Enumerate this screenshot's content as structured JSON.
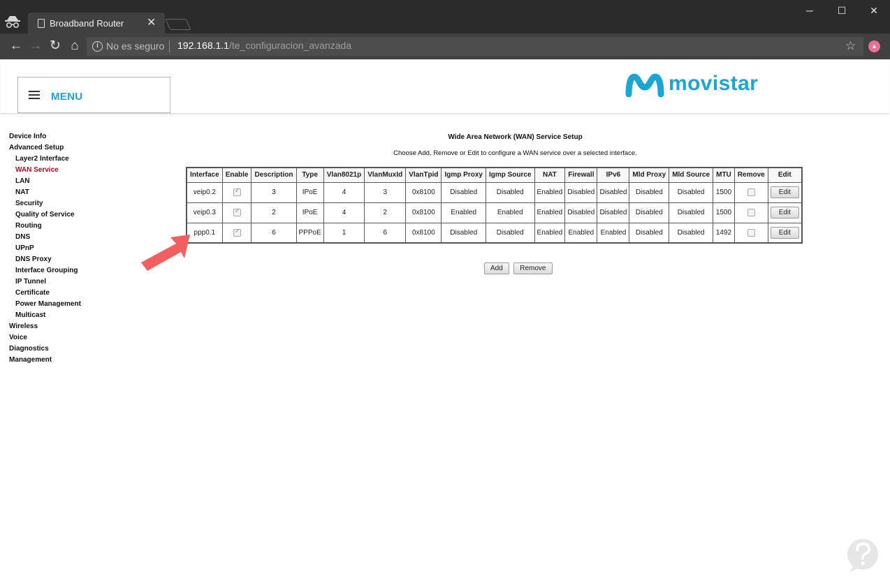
{
  "browser": {
    "tab_title": "Broadband Router",
    "security_text": "No es seguro",
    "url_host": "192.168.1.1",
    "url_path": "/te_configuracion_avanzada"
  },
  "header": {
    "menu_label": "MENU",
    "logo_text": "movistar",
    "brand_color": "#1aa6d2"
  },
  "left_nav": {
    "items": [
      {
        "label": "Device Info",
        "level": 0
      },
      {
        "label": "Advanced Setup",
        "level": 0
      },
      {
        "label": "Layer2 Interface",
        "level": 1
      },
      {
        "label": "WAN Service",
        "level": 1,
        "active": true
      },
      {
        "label": "LAN",
        "level": 1
      },
      {
        "label": "NAT",
        "level": 1
      },
      {
        "label": "Security",
        "level": 1
      },
      {
        "label": "Quality of Service",
        "level": 1
      },
      {
        "label": "Routing",
        "level": 1
      },
      {
        "label": "DNS",
        "level": 1
      },
      {
        "label": "UPnP",
        "level": 1
      },
      {
        "label": "DNS Proxy",
        "level": 1
      },
      {
        "label": "Interface Grouping",
        "level": 1
      },
      {
        "label": "IP Tunnel",
        "level": 1
      },
      {
        "label": "Certificate",
        "level": 1
      },
      {
        "label": "Power Management",
        "level": 1
      },
      {
        "label": "Multicast",
        "level": 1
      },
      {
        "label": "Wireless",
        "level": 0
      },
      {
        "label": "Voice",
        "level": 0
      },
      {
        "label": "Diagnostics",
        "level": 0
      },
      {
        "label": "Management",
        "level": 0
      }
    ],
    "active_color": "#c4051c"
  },
  "content": {
    "title": "Wide Area Network (WAN) Service Setup",
    "description": "Choose Add, Remove or Edit to configure a WAN service over a selected interface."
  },
  "wan_table": {
    "headers": [
      "Interface",
      "Enable",
      "Description",
      "Type",
      "Vlan8021p",
      "VlanMuxId",
      "VlanTpid",
      "Igmp Proxy",
      "Igmp Source",
      "NAT",
      "Firewall",
      "IPv6",
      "Mld Proxy",
      "Mld Source",
      "MTU",
      "Remove",
      "Edit"
    ],
    "rows": [
      {
        "interface": "veip0.2",
        "enable": true,
        "description": "3",
        "type": "IPoE",
        "vlan8021p": "4",
        "vlanmuxid": "3",
        "vlantpid": "0x8100",
        "igmp_proxy": "Disabled",
        "igmp_source": "Disabled",
        "nat": "Enabled",
        "firewall": "Disabled",
        "ipv6": "Disabled",
        "mld_proxy": "Disabled",
        "mld_source": "Disabled",
        "mtu": "1500",
        "remove": false,
        "edit_label": "Edit"
      },
      {
        "interface": "veip0.3",
        "enable": true,
        "description": "2",
        "type": "IPoE",
        "vlan8021p": "4",
        "vlanmuxid": "2",
        "vlantpid": "0x8100",
        "igmp_proxy": "Enabled",
        "igmp_source": "Enabled",
        "nat": "Enabled",
        "firewall": "Disabled",
        "ipv6": "Disabled",
        "mld_proxy": "Disabled",
        "mld_source": "Disabled",
        "mtu": "1500",
        "remove": false,
        "edit_label": "Edit"
      },
      {
        "interface": "ppp0.1",
        "enable": true,
        "description": "6",
        "type": "PPPoE",
        "vlan8021p": "1",
        "vlanmuxid": "6",
        "vlantpid": "0x8100",
        "igmp_proxy": "Disabled",
        "igmp_source": "Disabled",
        "nat": "Enabled",
        "firewall": "Enabled",
        "ipv6": "Enabled",
        "mld_proxy": "Disabled",
        "mld_source": "Disabled",
        "mtu": "1492",
        "remove": false,
        "edit_label": "Edit"
      }
    ]
  },
  "actions": {
    "add_label": "Add",
    "remove_label": "Remove"
  },
  "annotation": {
    "arrow_color": "#f25f5f"
  }
}
